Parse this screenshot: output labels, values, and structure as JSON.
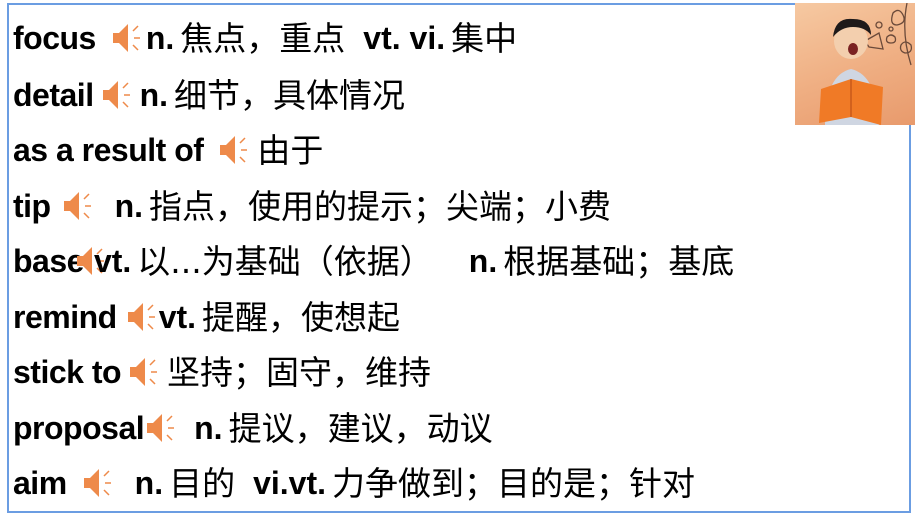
{
  "accent_colors": {
    "border": "#6b9de2",
    "speaker": "#ee8a4a"
  },
  "illustration": {
    "name": "boy-reading-book-photo",
    "description": "Boy shouting while holding an orange open book, doodles of megaphone and bubbles"
  },
  "entries": [
    {
      "word": "focus",
      "parts": [
        {
          "pos": "n.",
          "meaning": "焦点，重点"
        },
        {
          "pos": "vt. vi.",
          "meaning": "集中"
        }
      ]
    },
    {
      "word": "detail",
      "parts": [
        {
          "pos": "n.",
          "meaning": "细节，具体情况"
        }
      ]
    },
    {
      "word": "as a result of",
      "parts": [
        {
          "pos": "",
          "meaning": "由于"
        }
      ]
    },
    {
      "word": "tip",
      "parts": [
        {
          "pos": "n.",
          "meaning": "指点，使用的提示；尖端；小费"
        }
      ]
    },
    {
      "word": "base",
      "parts": [
        {
          "pos": "vt.",
          "meaning": "以...为基础（依据）"
        },
        {
          "pos": "n.",
          "meaning": "根据基础；基底"
        }
      ]
    },
    {
      "word": "remind",
      "parts": [
        {
          "pos": "vt.",
          "meaning": "提醒，使想起"
        }
      ]
    },
    {
      "word": "stick to",
      "parts": [
        {
          "pos": "",
          "meaning": "坚持；固守，维持"
        }
      ]
    },
    {
      "word": "proposal",
      "parts": [
        {
          "pos": "n.",
          "meaning": "提议，建议，动议"
        }
      ]
    },
    {
      "word": "aim",
      "parts": [
        {
          "pos": "n.",
          "meaning": "目的"
        },
        {
          "pos": "vi.vt.",
          "meaning": "力争做到；目的是；针对"
        }
      ]
    }
  ]
}
